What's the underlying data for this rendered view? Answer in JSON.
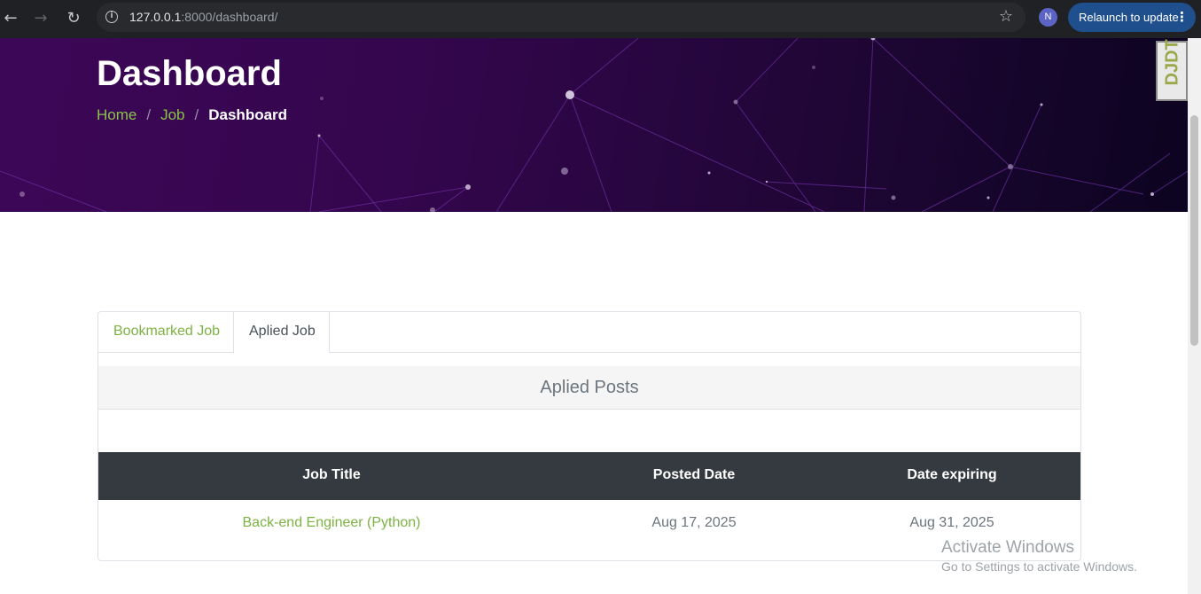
{
  "browser": {
    "url_host": "127.0.0.1",
    "url_path": ":8000/dashboard/",
    "profile_initial": "N",
    "relaunch_label": "Relaunch to update"
  },
  "hero": {
    "title": "Dashboard",
    "breadcrumb": {
      "home": "Home",
      "job": "Job",
      "current": "Dashboard",
      "separator": "/"
    },
    "badge_text": "DJDT"
  },
  "tabs": [
    {
      "label": "Bookmarked Job",
      "active": false
    },
    {
      "label": "Aplied Job",
      "active": true
    }
  ],
  "section_title": "Aplied Posts",
  "table": {
    "columns": [
      "Job Title",
      "Posted Date",
      "Date expiring"
    ],
    "rows": [
      {
        "title": "Back-end Engineer (Python)",
        "posted": "Aug 17, 2025",
        "expiring": "Aug 31, 2025"
      }
    ]
  },
  "watermark": {
    "line1": "Activate Windows",
    "line2": "Go to Settings to activate Windows."
  },
  "colors": {
    "accent": "#7cb342",
    "hero_bg": "#34064d",
    "table_head": "#343a40"
  }
}
